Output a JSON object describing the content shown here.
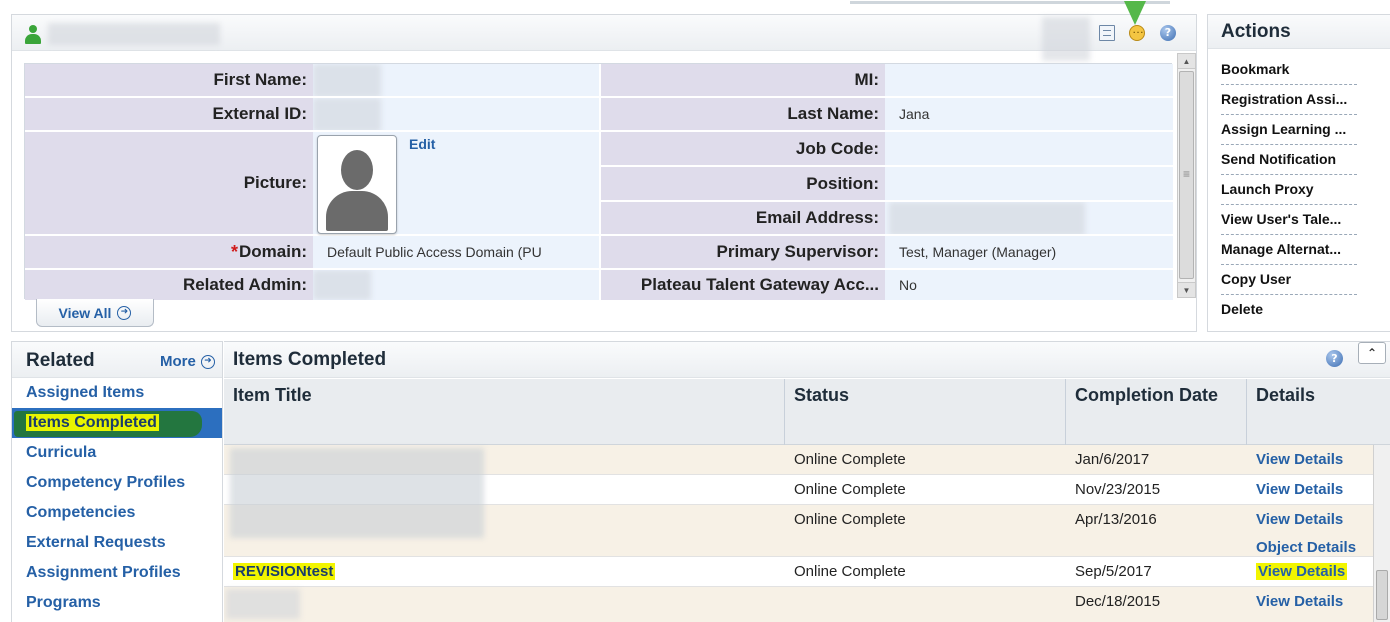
{
  "profile": {
    "header_name": "",
    "fields": {
      "first_name": {
        "label": "First Name:",
        "value": ""
      },
      "external_id": {
        "label": "External ID:",
        "value": ""
      },
      "picture": {
        "label": "Picture:",
        "edit": "Edit"
      },
      "domain": {
        "label": "Domain:",
        "required": "*",
        "value": "Default Public Access Domain (PU"
      },
      "related_admin": {
        "label": "Related Admin:",
        "value": ""
      },
      "mi": {
        "label": "MI:",
        "value": ""
      },
      "last_name": {
        "label": "Last Name:",
        "value": "Jana"
      },
      "job_code": {
        "label": "Job Code:",
        "value": ""
      },
      "position": {
        "label": "Position:",
        "value": ""
      },
      "email": {
        "label": "Email Address:",
        "value": ""
      },
      "primary_supervisor": {
        "label": "Primary Supervisor:",
        "value": "Test, Manager  (Manager)"
      },
      "plateau": {
        "label": "Plateau Talent Gateway Acc...",
        "value": "No"
      }
    },
    "view_all": "View All"
  },
  "actions": {
    "title": "Actions",
    "items": [
      "Bookmark",
      "Registration Assi...",
      "Assign Learning ...",
      "Send Notification",
      "Launch Proxy",
      "View User's Tale...",
      "Manage Alternat...",
      "Copy User",
      "Delete"
    ]
  },
  "related": {
    "title": "Related",
    "more": "More",
    "items": [
      "Assigned Items",
      "Items Completed",
      "Curricula",
      "Competency Profiles",
      "Competencies",
      "External Requests",
      "Assignment Profiles",
      "Programs"
    ],
    "selected_index": 1
  },
  "items_completed": {
    "title": "Items Completed",
    "columns": [
      "Item Title",
      "Status",
      "Completion Date",
      "Details"
    ],
    "rows": [
      {
        "title": "",
        "status": "Online Complete",
        "date": "Jan/6/2017",
        "details": "View Details"
      },
      {
        "title": "",
        "status": "Online Complete",
        "date": "Nov/23/2015",
        "details": "View Details"
      },
      {
        "title": "",
        "status": "Online Complete",
        "date": "Apr/13/2016",
        "details": "View Details",
        "extra": "Object Details"
      },
      {
        "title": "REVISIONtest",
        "status": "Online Complete",
        "date": "Sep/5/2017",
        "details": "View Details"
      },
      {
        "title": "",
        "status": "",
        "date": "Dec/18/2015",
        "details": "View Details"
      }
    ]
  },
  "icons": {
    "user": "user-icon",
    "document": "document-icon",
    "chat": "chat-bubble-icon",
    "help": "help-icon",
    "circle_arrow": "circle-arrow-icon",
    "collapse": "collapse-icon"
  },
  "colors": {
    "link": "#2560a6",
    "label_bg": "#dfdceb",
    "value_bg": "#ecf3fc",
    "selected_bg": "#2c6fbf",
    "highlight": "#f2f500"
  }
}
